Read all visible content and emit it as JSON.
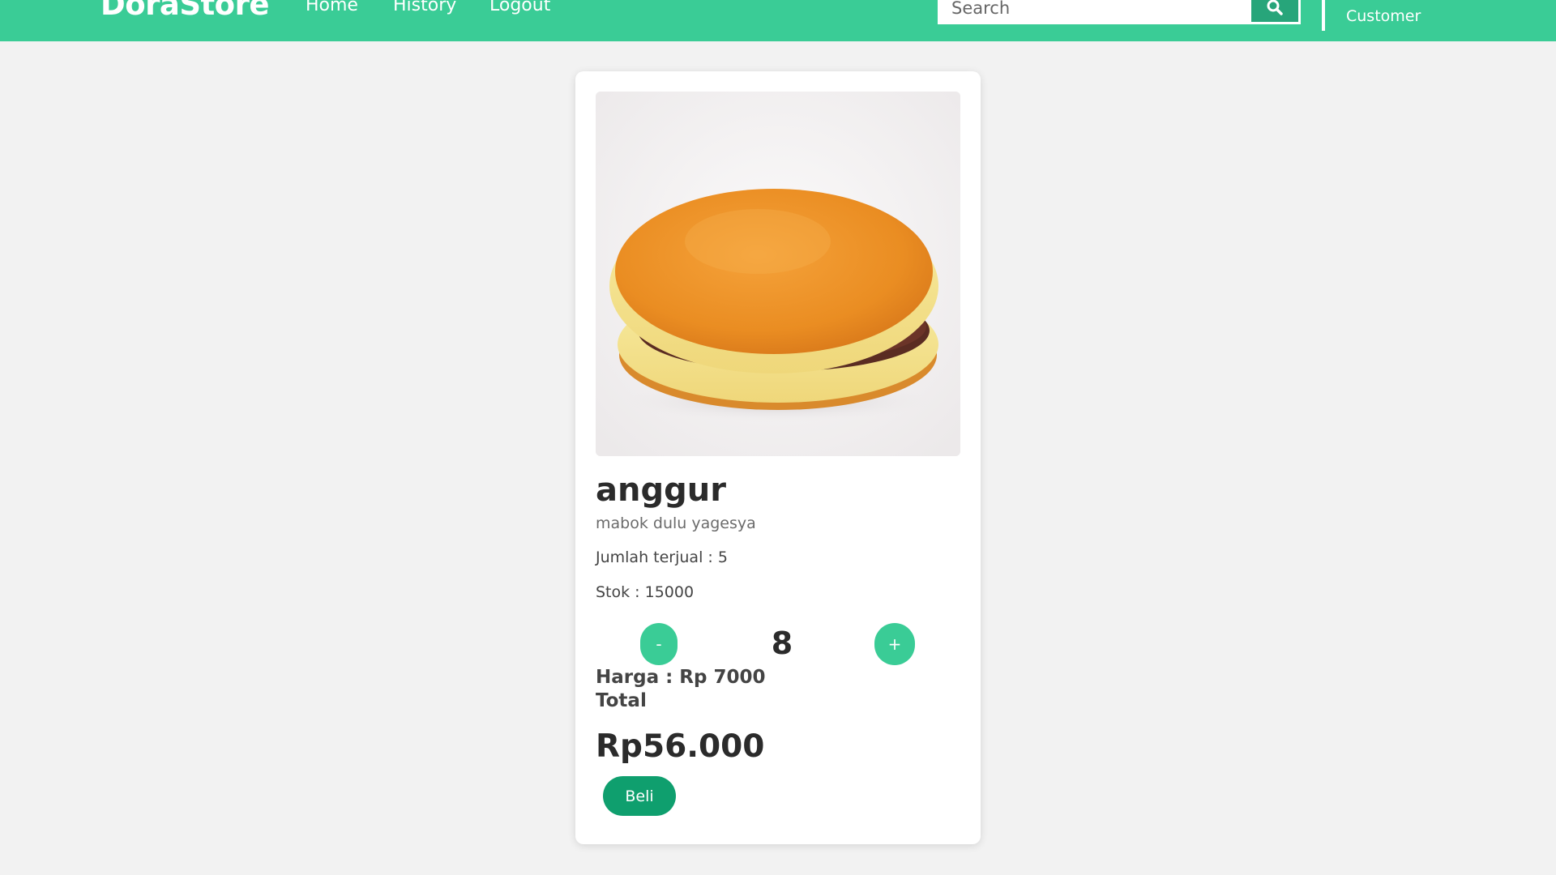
{
  "header": {
    "brand": "DoraStore",
    "nav": {
      "home": "Home",
      "history": "History",
      "logout": "Logout"
    },
    "search": {
      "placeholder": "Search",
      "button_icon": "search-icon"
    },
    "user": {
      "role": "Customer"
    }
  },
  "product": {
    "name": "anggur",
    "description": "mabok dulu yagesya",
    "sold_line": "Jumlah terjual : 5",
    "stock_line": "Stok : 15000",
    "quantity": "8",
    "minus_label": "-",
    "plus_label": "+",
    "price_line": "Harga : Rp 7000",
    "total_label": "Total",
    "total_value": "Rp56.000",
    "buy_label": "Beli"
  },
  "colors": {
    "primary": "#3acc96",
    "buy_button": "#0f9f6e",
    "search_button": "#27a57a",
    "page_background": "#f2f2f2"
  }
}
